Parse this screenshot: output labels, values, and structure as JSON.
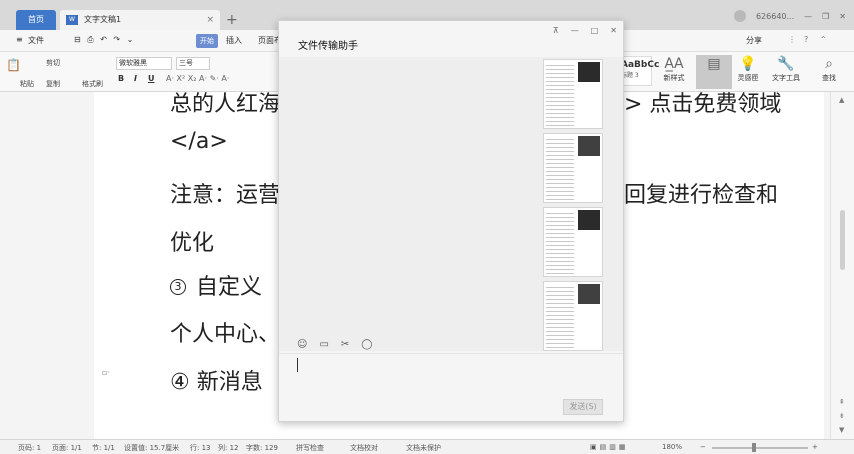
{
  "titlebar": {
    "home_tab": "首页",
    "doc_tab": "文字文稿1",
    "doc_badge": "W",
    "close": "×",
    "add": "+",
    "user": "626640...",
    "minimize": "—",
    "maximize": "❐",
    "win_close": "✕"
  },
  "menubar": {
    "file": "文件",
    "start": "开始",
    "insert": "插入",
    "layout": "页面布",
    "share": "分享",
    "icons": "⊟ ⎙ ↶ ↷ ⌄"
  },
  "ribbon": {
    "paste": "粘贴",
    "cut": "剪切",
    "copy": "复制",
    "format_painter": "格式刷",
    "font": "微软雅黑",
    "size": "三号",
    "bold": "B",
    "italic": "I",
    "underline": "U",
    "style_sample": "AaBbCc",
    "style_name": "标题 3",
    "new_style": "新样式",
    "inspiration": "灵感匣",
    "text_tools": "文字工具",
    "find_replace": "查找"
  },
  "document": {
    "line1": "总的人红海 ",
    "line1_right": "> 点击免费领域",
    "line2": "</a>",
    "line3": "注意：运营",
    "line3_right": "回复进行检查和",
    "line4": "优化",
    "line5_num": "3",
    "line5": "自定义",
    "line6": "个人中心、",
    "line7": "④  新消息"
  },
  "chat": {
    "title": "文件传输助手",
    "pin": "⊼",
    "minimize": "—",
    "maximize": "□",
    "close": "✕",
    "send": "发送(S)",
    "toolbar_icons": [
      "☺",
      "▭",
      "✂",
      "◯"
    ]
  },
  "statusbar": {
    "page": "页码: 1",
    "pages": "页面: 1/1",
    "section": "节: 1/1",
    "setting": "设置值: 15.7厘米",
    "row": "行: 13",
    "col": "列: 12",
    "words": "字数: 129",
    "spell": "拼写检查",
    "proof": "文档校对",
    "protect": "文档未保护",
    "zoom": "180%"
  }
}
